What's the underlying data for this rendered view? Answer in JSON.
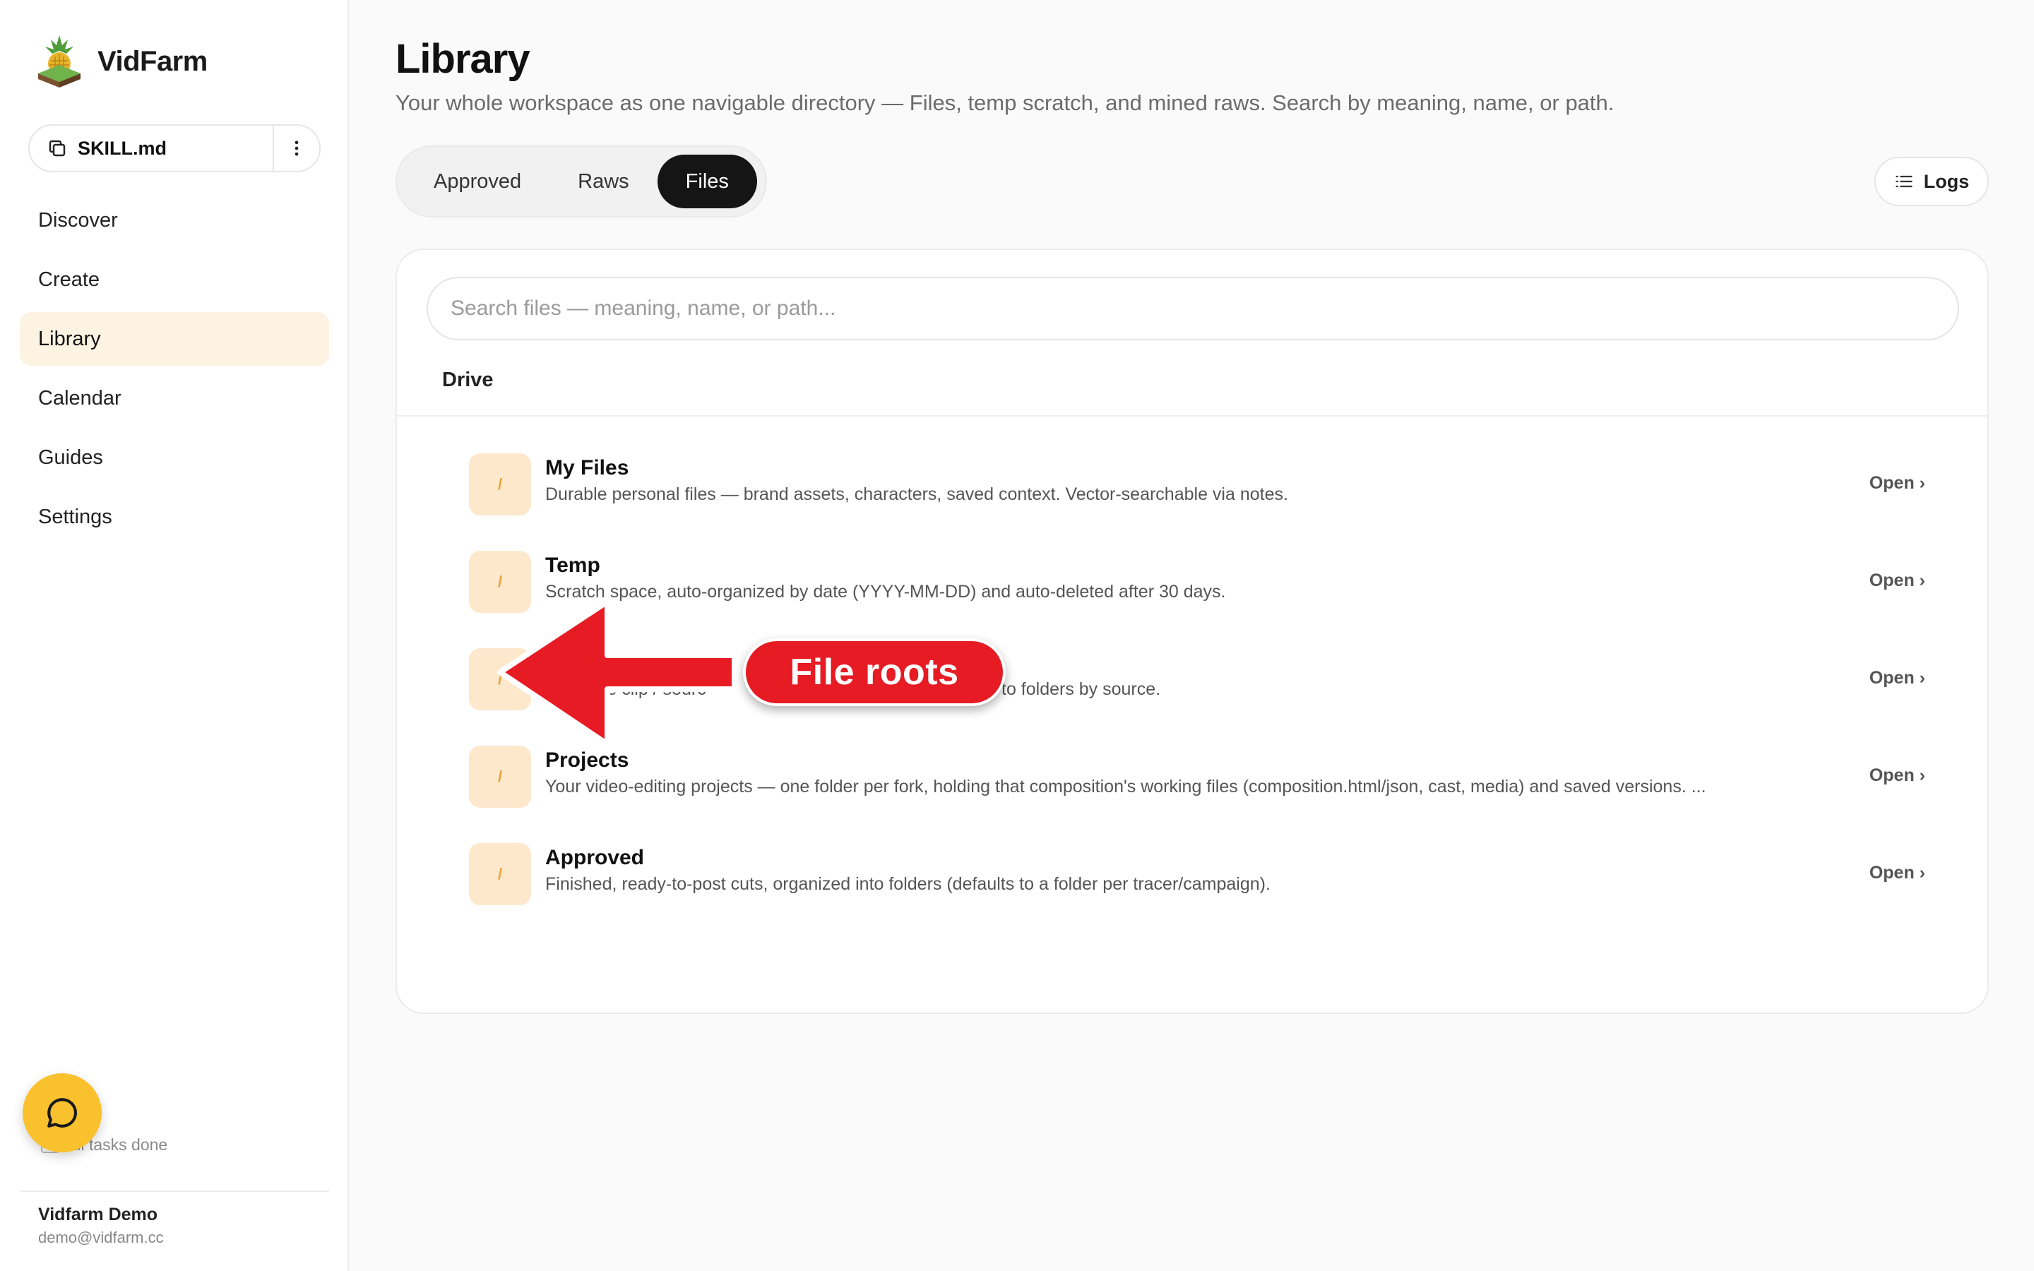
{
  "app": {
    "name": "VidFarm"
  },
  "sidebar": {
    "skill_file": "SKILL.md",
    "nav": [
      {
        "label": "Discover",
        "active": false
      },
      {
        "label": "Create",
        "active": false
      },
      {
        "label": "Library",
        "active": true
      },
      {
        "label": "Calendar",
        "active": false
      },
      {
        "label": "Guides",
        "active": false
      },
      {
        "label": "Settings",
        "active": false
      }
    ],
    "tasks_status": "All tasks done",
    "user": {
      "name": "Vidfarm Demo",
      "email": "demo@vidfarm.cc"
    }
  },
  "header": {
    "title": "Library",
    "subtitle": "Your whole workspace as one navigable directory — Files, temp scratch, and mined raws. Search by meaning, name, or path."
  },
  "tabs": [
    {
      "label": "Approved",
      "active": false
    },
    {
      "label": "Raws",
      "active": false
    },
    {
      "label": "Files",
      "active": true
    }
  ],
  "logs_label": "Logs",
  "search": {
    "placeholder": "Search files — meaning, name, or path...",
    "value": ""
  },
  "drive": {
    "label": "Drive",
    "folder_glyph": "/",
    "roots": [
      {
        "title": "My Files",
        "description": "Durable personal files — brand assets, characters, saved context. Vector-searchable via notes.",
        "action": "Open ›"
      },
      {
        "title": "Temp",
        "description": "Scratch space, auto-organized by date (YYYY-MM-DD) and auto-deleted after 30 days.",
        "action": "Open ›"
      },
      {
        "title": "",
        "description_visible_start": "able clip / sourc",
        "description_visible_end": "to folders by source.",
        "action": "Open ›"
      },
      {
        "title": "Projects",
        "description": "Your video-editing projects — one folder per fork, holding that composition's working files (composition.html/json, cast, media) and saved versions. ...",
        "action": "Open ›"
      },
      {
        "title": "Approved",
        "description": "Finished, ready-to-post cuts, organized into folders (defaults to a folder per tracer/campaign).",
        "action": "Open ›"
      }
    ]
  },
  "annotation": {
    "label": "File roots",
    "color": "#e61b23"
  },
  "colors": {
    "accent": "#f9c12e",
    "active_nav_bg": "#fdf3e2",
    "folder_icon_bg": "#fde8cc",
    "active_tab_bg": "#151515"
  },
  "icons": {
    "brand": "pineapple-logo-icon",
    "skill": "copy-icon",
    "skill_menu": "more-vertical-icon",
    "logs": "list-icon",
    "chat": "chat-bubble-icon",
    "tasks": "checkbox-icon",
    "annotation": "arrow-left-icon"
  }
}
